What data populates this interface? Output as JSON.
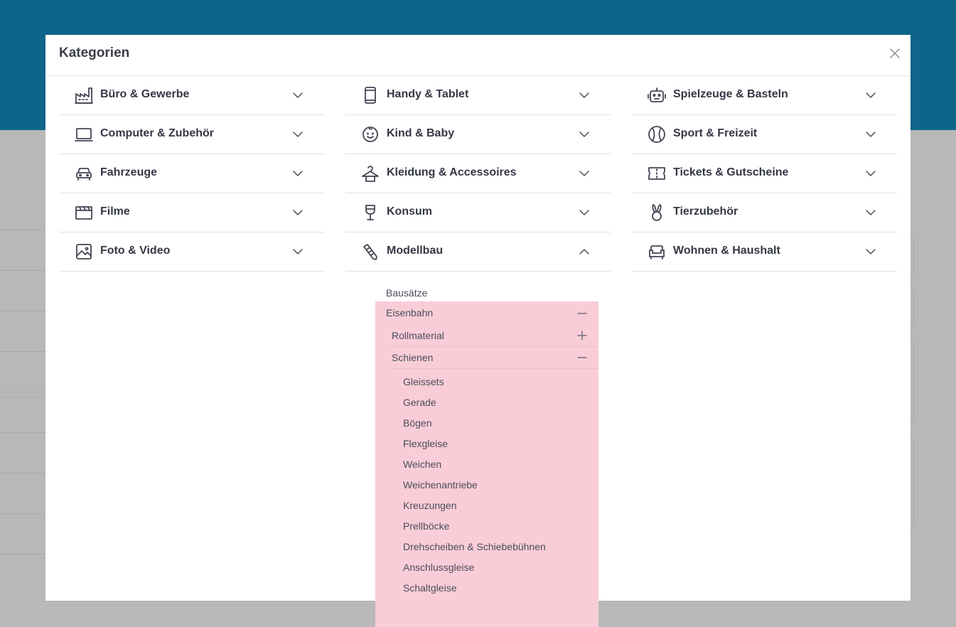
{
  "modal": {
    "title": "Kategorien"
  },
  "columns": [
    [
      {
        "label": "Büro & Gewerbe",
        "icon": "factory-icon",
        "expanded": false
      },
      {
        "label": "Computer & Zubehör",
        "icon": "laptop-icon",
        "expanded": false
      },
      {
        "label": "Fahrzeuge",
        "icon": "car-icon",
        "expanded": false
      },
      {
        "label": "Filme",
        "icon": "clapperboard-icon",
        "expanded": false
      },
      {
        "label": "Foto & Video",
        "icon": "image-icon",
        "expanded": false
      }
    ],
    [
      {
        "label": "Handy & Tablet",
        "icon": "smartphone-icon",
        "expanded": false
      },
      {
        "label": "Kind & Baby",
        "icon": "baby-face-icon",
        "expanded": false
      },
      {
        "label": "Kleidung & Accessoires",
        "icon": "hanger-icon",
        "expanded": false
      },
      {
        "label": "Konsum",
        "icon": "wine-glass-icon",
        "expanded": false
      },
      {
        "label": "Modellbau",
        "icon": "ruler-pencil-icon",
        "expanded": true
      }
    ],
    [
      {
        "label": "Spielzeuge & Basteln",
        "icon": "robot-icon",
        "expanded": false
      },
      {
        "label": "Sport & Freizeit",
        "icon": "baseball-icon",
        "expanded": false
      },
      {
        "label": "Tickets & Gutscheine",
        "icon": "ticket-icon",
        "expanded": false
      },
      {
        "label": "Tierzubehör",
        "icon": "rabbit-icon",
        "expanded": false
      },
      {
        "label": "Wohnen & Haushalt",
        "icon": "sofa-icon",
        "expanded": false
      }
    ]
  ],
  "modellbau": {
    "bausaetze": "Bausätze",
    "eisenbahn": "Eisenbahn",
    "rollmaterial": "Rollmaterial",
    "schienen": "Schienen",
    "schienen_items": [
      "Gleissets",
      "Gerade",
      "Bögen",
      "Flexgleise",
      "Weichen",
      "Weichenantriebe",
      "Kreuzungen",
      "Prellböcke",
      "Drehscheiben & Schiebebühnen",
      "Anschlussgleise",
      "Schaltgleise"
    ]
  },
  "colors": {
    "header_bg": "#0e6589",
    "highlight": "#f9cdd8"
  }
}
